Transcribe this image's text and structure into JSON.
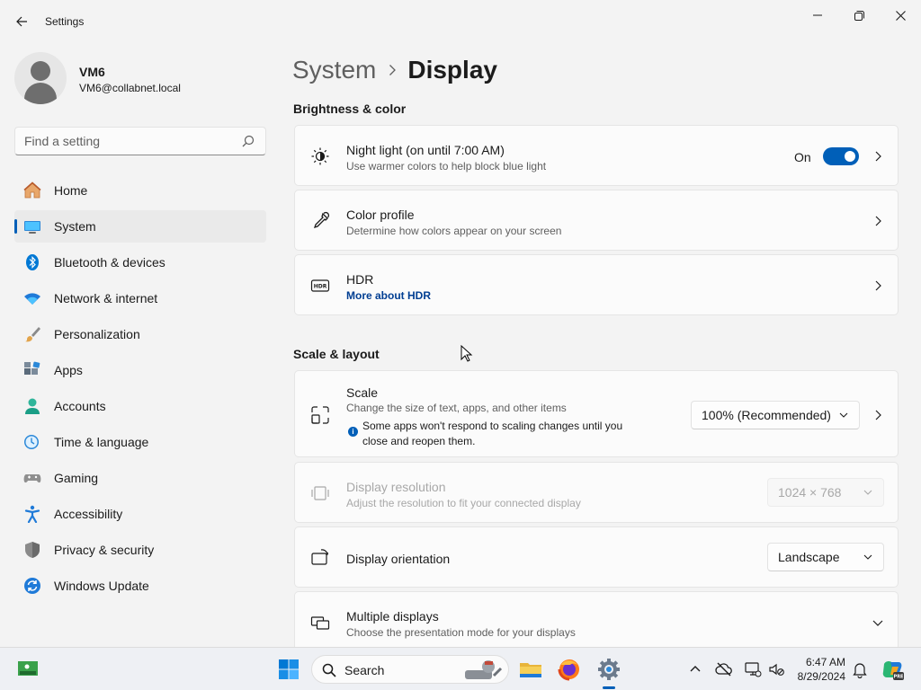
{
  "window": {
    "title": "Settings"
  },
  "profile": {
    "name": "VM6",
    "email": "VM6@collabnet.local"
  },
  "search": {
    "placeholder": "Find a setting"
  },
  "sidebar": {
    "items": [
      {
        "label": "Home",
        "icon": "home-icon"
      },
      {
        "label": "System",
        "icon": "monitor-icon",
        "selected": true
      },
      {
        "label": "Bluetooth & devices",
        "icon": "bluetooth-icon"
      },
      {
        "label": "Network & internet",
        "icon": "wifi-icon"
      },
      {
        "label": "Personalization",
        "icon": "brush-icon"
      },
      {
        "label": "Apps",
        "icon": "apps-icon"
      },
      {
        "label": "Accounts",
        "icon": "person-icon"
      },
      {
        "label": "Time & language",
        "icon": "globe-clock-icon"
      },
      {
        "label": "Gaming",
        "icon": "gamepad-icon"
      },
      {
        "label": "Accessibility",
        "icon": "accessibility-icon"
      },
      {
        "label": "Privacy & security",
        "icon": "shield-icon"
      },
      {
        "label": "Windows Update",
        "icon": "update-icon"
      }
    ]
  },
  "breadcrumb": {
    "parent": "System",
    "current": "Display"
  },
  "sections": {
    "brightness": "Brightness & color",
    "scale_layout": "Scale & layout"
  },
  "cards": {
    "night_light": {
      "title": "Night light (on until 7:00 AM)",
      "subtitle": "Use warmer colors to help block blue light",
      "toggle_label": "On",
      "toggle_on": true
    },
    "color_profile": {
      "title": "Color profile",
      "subtitle": "Determine how colors appear on your screen"
    },
    "hdr": {
      "title": "HDR",
      "link": "More about HDR"
    },
    "scale": {
      "title": "Scale",
      "subtitle": "Change the size of text, apps, and other items",
      "info": "Some apps won't respond to scaling changes until you close and reopen them.",
      "value": "100% (Recommended)"
    },
    "resolution": {
      "title": "Display resolution",
      "subtitle": "Adjust the resolution to fit your connected display",
      "value": "1024 × 768"
    },
    "orientation": {
      "title": "Display orientation",
      "value": "Landscape"
    },
    "multiple": {
      "title": "Multiple displays",
      "subtitle": "Choose the presentation mode for your displays"
    }
  },
  "taskbar": {
    "search_label": "Search",
    "time": "6:47 AM",
    "date": "8/29/2024"
  },
  "colors": {
    "accent": "#005fb8",
    "background": "#f3f3f3",
    "card": "#fbfbfb"
  }
}
